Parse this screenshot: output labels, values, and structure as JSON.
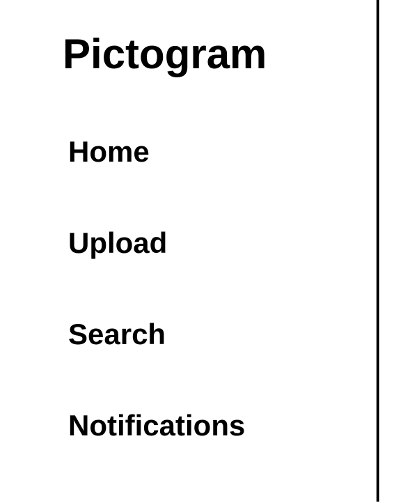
{
  "sidebar": {
    "title": "Pictogram",
    "items": [
      {
        "label": "Home"
      },
      {
        "label": "Upload"
      },
      {
        "label": "Search"
      },
      {
        "label": "Notifications"
      }
    ]
  }
}
